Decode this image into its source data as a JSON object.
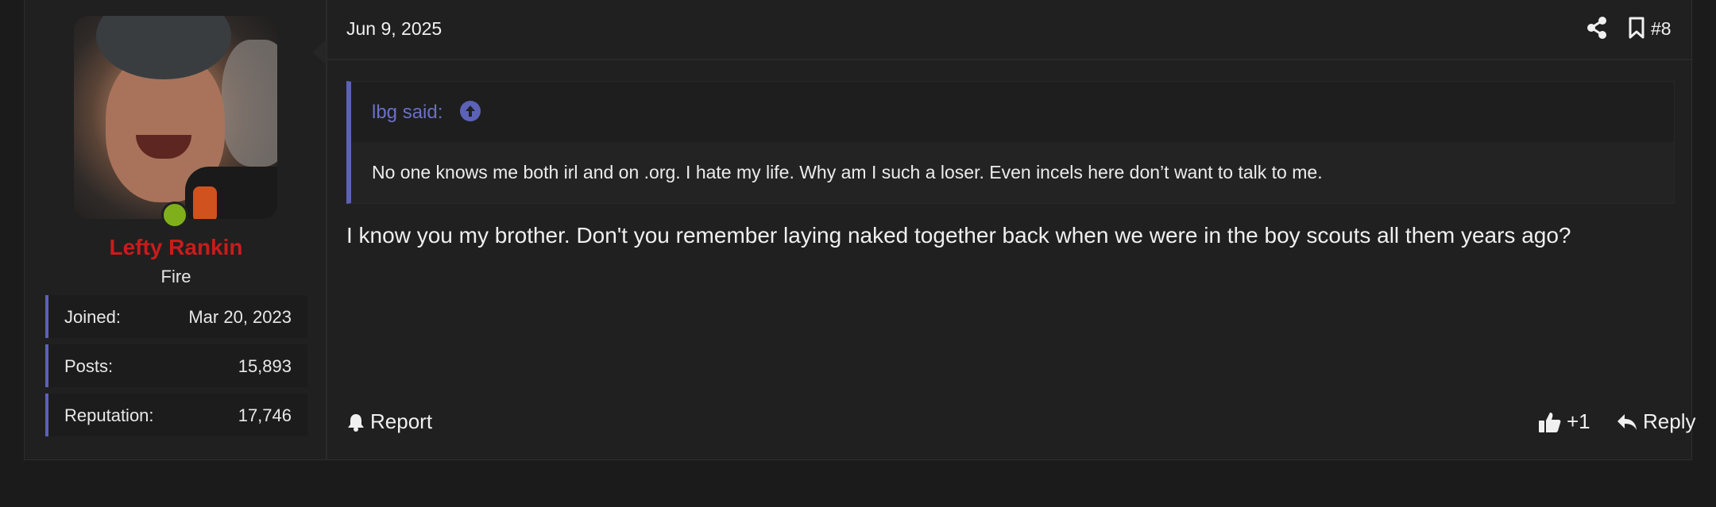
{
  "user": {
    "name": "Lefty Rankin",
    "title": "Fire",
    "stats": [
      {
        "label": "Joined:",
        "value": "Mar 20, 2023"
      },
      {
        "label": "Posts:",
        "value": "15,893"
      },
      {
        "label": "Reputation:",
        "value": "17,746"
      }
    ],
    "online_color": "#7fb01c",
    "name_color": "#c81c1c"
  },
  "post": {
    "date": "Jun 9, 2025",
    "number": "#8",
    "header_icons": [
      "share-icon",
      "bookmark-icon"
    ],
    "quote": {
      "author": "lbg said:",
      "text": "No one knows me both irl and on .org. I hate my life. Why am I such a loser. Even incels here don’t want to talk to me."
    },
    "message": "I know you my brother. Don't you remember laying naked together back when we were in the boy scouts all them years ago?",
    "footer": {
      "report_label": "Report",
      "reaction_label": "+1",
      "reply_label": "Reply"
    },
    "accent_color": "#5c62b8"
  }
}
